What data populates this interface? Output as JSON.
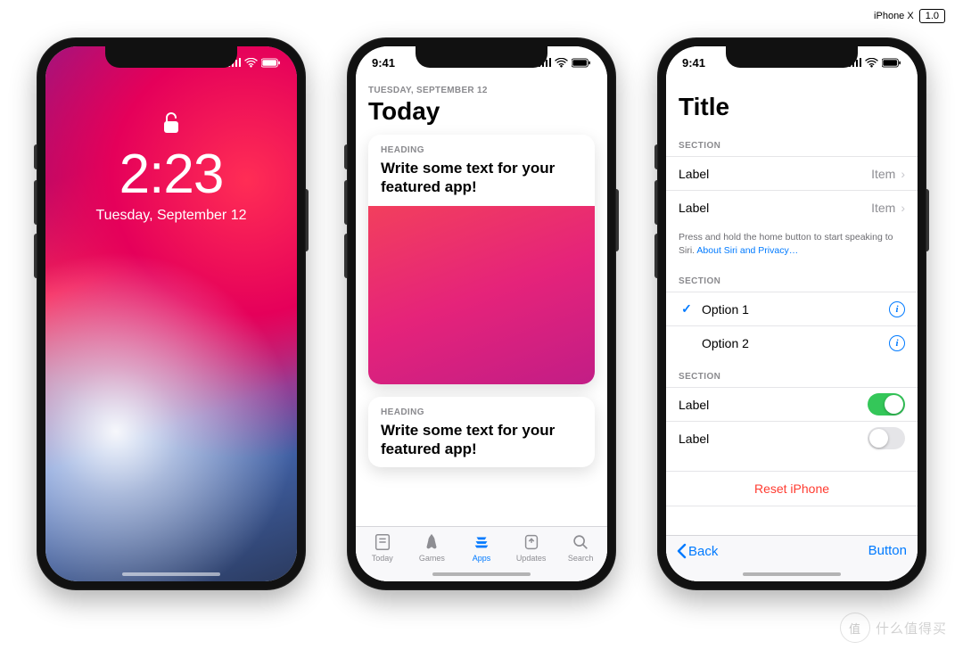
{
  "meta": {
    "device_label": "iPhone X",
    "version": "1.0"
  },
  "status": {
    "time": "9:41"
  },
  "lockscreen": {
    "time": "2:23",
    "date": "Tuesday, September 12"
  },
  "today": {
    "dateline": "TUESDAY, SEPTEMBER 12",
    "title": "Today",
    "cards": [
      {
        "heading": "HEADING",
        "text": "Write some text for your featured app!"
      },
      {
        "heading": "HEADING",
        "text": "Write some text for your featured app!"
      }
    ],
    "tabs": [
      {
        "label": "Today"
      },
      {
        "label": "Games"
      },
      {
        "label": "Apps"
      },
      {
        "label": "Updates"
      },
      {
        "label": "Search"
      }
    ]
  },
  "settings": {
    "title": "Title",
    "section1": {
      "header": "SECTION",
      "rows": [
        {
          "label": "Label",
          "value": "Item"
        },
        {
          "label": "Label",
          "value": "Item"
        }
      ]
    },
    "footer": {
      "text": "Press and hold the home button to start speaking to Siri. ",
      "link": "About Siri and Privacy…"
    },
    "section2": {
      "header": "SECTION",
      "rows": [
        {
          "label": "Option 1",
          "checked": true
        },
        {
          "label": "Option 2",
          "checked": false
        }
      ]
    },
    "section3": {
      "header": "SECTION",
      "rows": [
        {
          "label": "Label",
          "on": true
        },
        {
          "label": "Label",
          "on": false
        }
      ]
    },
    "reset": "Reset iPhone",
    "toolbar": {
      "back": "Back",
      "button": "Button"
    }
  },
  "watermark": "什么值得买"
}
